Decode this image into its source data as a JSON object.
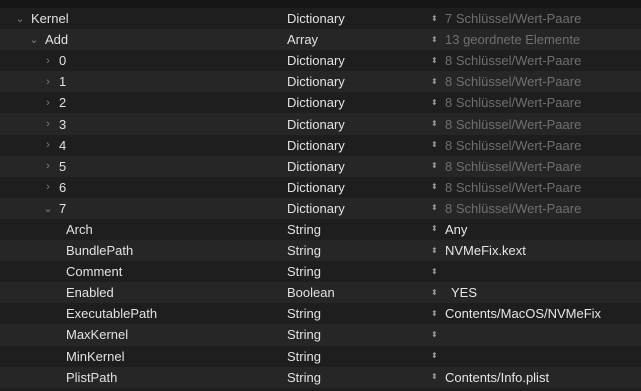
{
  "rows": [
    {
      "key": "Kernel",
      "indent": 0,
      "disclosure": "open",
      "type": "Dictionary",
      "value": "7 Schlüssel/Wert-Paare",
      "dim": true
    },
    {
      "key": "Add",
      "indent": 1,
      "disclosure": "open",
      "type": "Array",
      "value": "13 geordnete Elemente",
      "dim": true
    },
    {
      "key": "0",
      "indent": 2,
      "disclosure": "closed",
      "type": "Dictionary",
      "value": "8 Schlüssel/Wert-Paare",
      "dim": true
    },
    {
      "key": "1",
      "indent": 2,
      "disclosure": "closed",
      "type": "Dictionary",
      "value": "8 Schlüssel/Wert-Paare",
      "dim": true
    },
    {
      "key": "2",
      "indent": 2,
      "disclosure": "closed",
      "type": "Dictionary",
      "value": "8 Schlüssel/Wert-Paare",
      "dim": true
    },
    {
      "key": "3",
      "indent": 2,
      "disclosure": "closed",
      "type": "Dictionary",
      "value": "8 Schlüssel/Wert-Paare",
      "dim": true
    },
    {
      "key": "4",
      "indent": 2,
      "disclosure": "closed",
      "type": "Dictionary",
      "value": "8 Schlüssel/Wert-Paare",
      "dim": true
    },
    {
      "key": "5",
      "indent": 2,
      "disclosure": "closed",
      "type": "Dictionary",
      "value": "8 Schlüssel/Wert-Paare",
      "dim": true
    },
    {
      "key": "6",
      "indent": 2,
      "disclosure": "closed",
      "type": "Dictionary",
      "value": "8 Schlüssel/Wert-Paare",
      "dim": true
    },
    {
      "key": "7",
      "indent": 2,
      "disclosure": "open",
      "type": "Dictionary",
      "value": "8 Schlüssel/Wert-Paare",
      "dim": true
    },
    {
      "key": "Arch",
      "indent": 3,
      "disclosure": "none",
      "type": "String",
      "value": "Any",
      "dim": false
    },
    {
      "key": "BundlePath",
      "indent": 3,
      "disclosure": "none",
      "type": "String",
      "value": "NVMeFix.kext",
      "dim": false
    },
    {
      "key": "Comment",
      "indent": 3,
      "disclosure": "none",
      "type": "String",
      "value": "",
      "dim": false
    },
    {
      "key": "Enabled",
      "indent": 3,
      "disclosure": "none",
      "type": "Boolean",
      "value": "YES",
      "dim": false,
      "bool": true
    },
    {
      "key": "ExecutablePath",
      "indent": 3,
      "disclosure": "none",
      "type": "String",
      "value": "Contents/MacOS/NVMeFix",
      "dim": false
    },
    {
      "key": "MaxKernel",
      "indent": 3,
      "disclosure": "none",
      "type": "String",
      "value": "",
      "dim": false
    },
    {
      "key": "MinKernel",
      "indent": 3,
      "disclosure": "none",
      "type": "String",
      "value": "",
      "dim": false
    },
    {
      "key": "PlistPath",
      "indent": 3,
      "disclosure": "none",
      "type": "String",
      "value": "Contents/Info.plist",
      "dim": false
    }
  ],
  "icons": {
    "disclosure_open": "chevron-down-icon",
    "disclosure_closed": "chevron-right-icon",
    "stepper": "stepper-icon"
  }
}
